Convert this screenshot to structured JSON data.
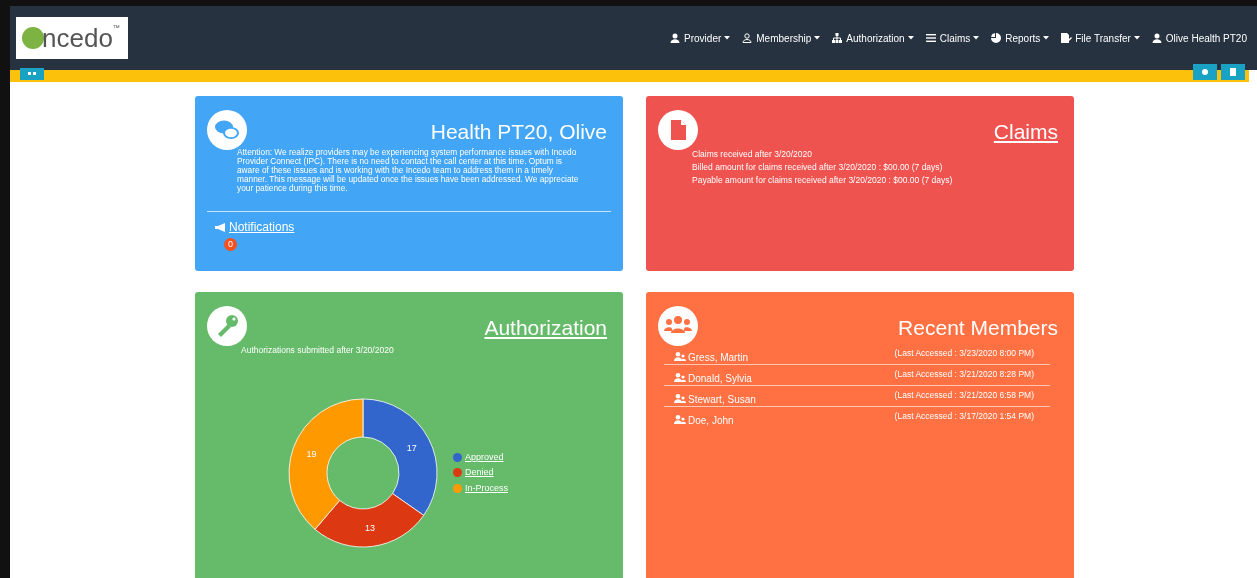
{
  "logo": {
    "text": "ncedo",
    "mark": "™"
  },
  "nav": [
    {
      "label": "Provider",
      "kind": "person",
      "dropdown": true
    },
    {
      "label": "Membership",
      "kind": "outline",
      "dropdown": true
    },
    {
      "label": "Authorization",
      "kind": "sitemap",
      "dropdown": true
    },
    {
      "label": "Claims",
      "kind": "list",
      "dropdown": true
    },
    {
      "label": "Reports",
      "kind": "pie",
      "dropdown": true
    },
    {
      "label": "File Transfer",
      "kind": "file",
      "dropdown": true
    },
    {
      "label": "Olive Health PT20",
      "kind": "person",
      "dropdown": false
    }
  ],
  "provider_card": {
    "title": "Health PT20, Olive",
    "message": "Attention: We realize providers may be experiencing system performance issues with Incedo Provider Connect (IPC). There is no need to contact the call center at this time. Optum is aware of these issues and is working with the Incedo team to address them in a timely manner. This message will be updated once the issues have been addressed. We appreciate your patience during this time.",
    "notifications_link": "Notifications",
    "notifications_count": "0"
  },
  "claims_card": {
    "title": "Claims",
    "lines": [
      "Claims received after 3/20/2020",
      "Billed amount for claims received after 3/20/2020 : $00.00 (7 days)",
      "Payable amount for claims received after 3/20/2020 : $00.00 (7 days)"
    ]
  },
  "authorization_card": {
    "title": "Authorization",
    "subtitle": "Authorizations submitted after 3/20/2020",
    "chart_data": {
      "type": "donut",
      "categories": [
        "Approved",
        "Denied",
        "In-Process"
      ],
      "legend": true,
      "series": [
        {
          "colors": [
            "#3366cc",
            "#dc3912",
            "#ff9900"
          ],
          "values": [
            17,
            13,
            19
          ]
        }
      ],
      "data_labels": true
    }
  },
  "members_card": {
    "title": "Recent Members",
    "members": [
      {
        "name": "Gress, Martin",
        "last_accessed": "(Last Accessed : 3/23/2020 8:00 PM)"
      },
      {
        "name": "Donald, Sylvia",
        "last_accessed": "(Last Accessed : 3/21/2020 8:28 PM)"
      },
      {
        "name": "Stewart, Susan",
        "last_accessed": "(Last Accessed : 3/21/2020 6:58 PM)"
      },
      {
        "name": "Doe, John",
        "last_accessed": "(Last Accessed : 3/17/2020 1:54 PM)"
      }
    ]
  }
}
